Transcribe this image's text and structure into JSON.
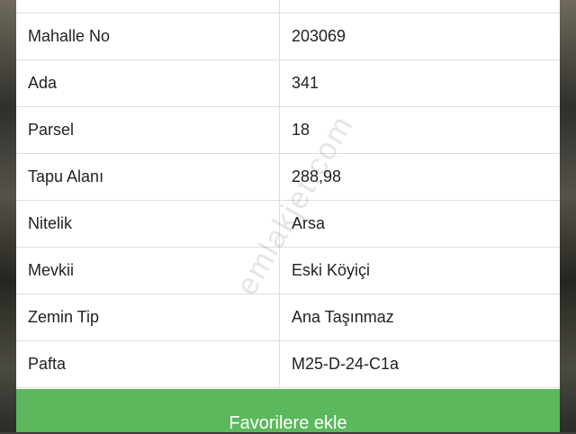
{
  "rows": [
    {
      "key": "",
      "value": ""
    },
    {
      "key": "Mahalle No",
      "value": "203069"
    },
    {
      "key": "Ada",
      "value": "341"
    },
    {
      "key": "Parsel",
      "value": "18"
    },
    {
      "key": "Tapu Alanı",
      "value": "288,98"
    },
    {
      "key": "Nitelik",
      "value": "Arsa"
    },
    {
      "key": "Mevkii",
      "value": "Eski Köyiçi"
    },
    {
      "key": "Zemin Tip",
      "value": "Ana Taşınmaz"
    },
    {
      "key": "Pafta",
      "value": "M25-D-24-C1a"
    }
  ],
  "favorite_button": {
    "label": "Favorilere ekle",
    "color": "#5cb85c"
  },
  "watermark": "emlakjet.com"
}
